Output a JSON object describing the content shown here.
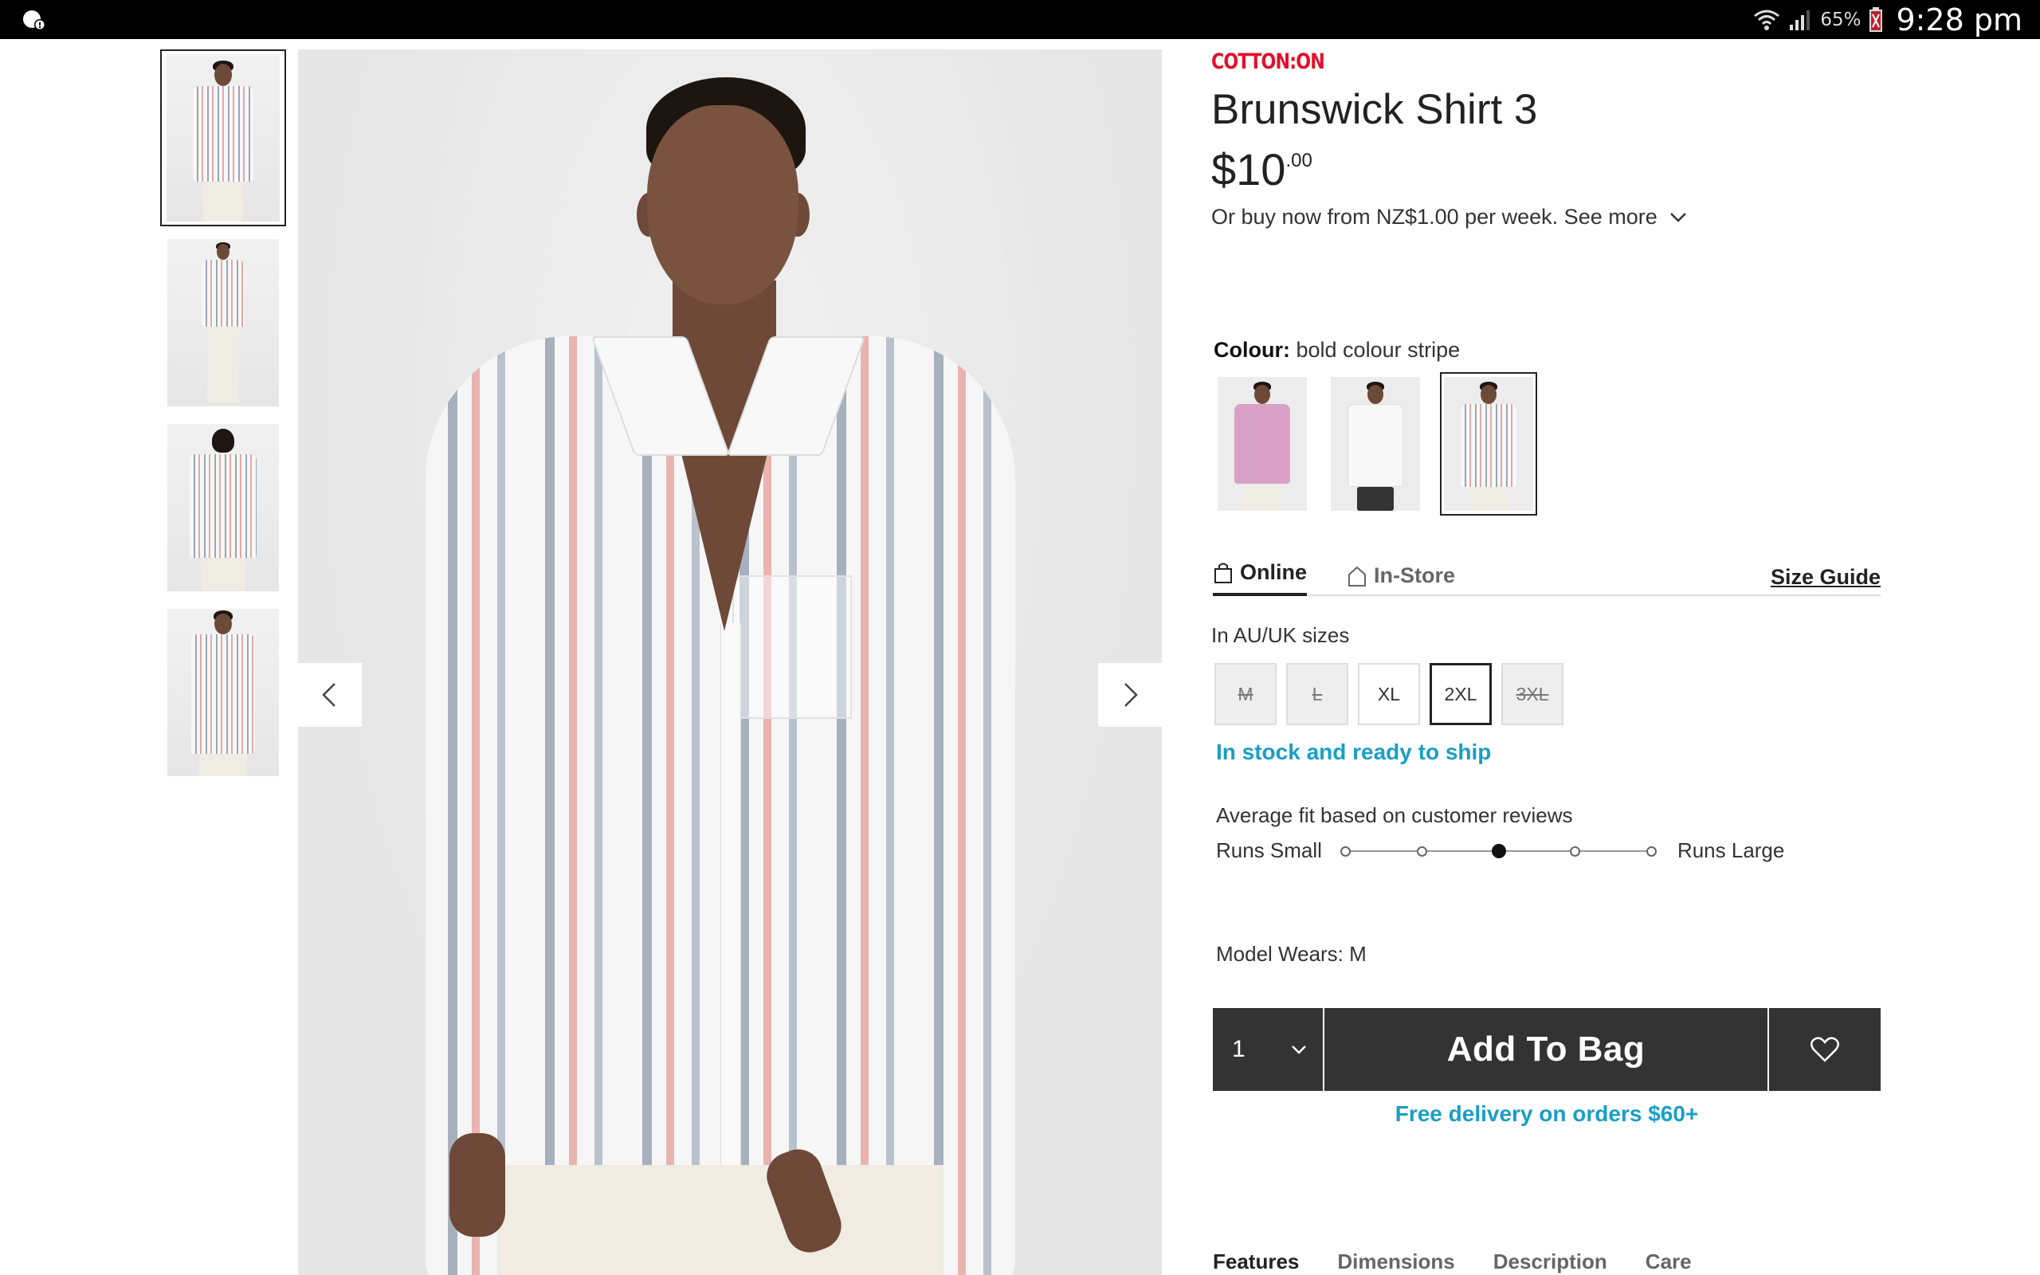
{
  "status_bar": {
    "battery": "65%",
    "time": "9:28 pm",
    "icons": [
      "notification-icon",
      "wifi-icon",
      "signal-icon",
      "battery-icon"
    ]
  },
  "gallery": {
    "thumbnails": [
      "front view",
      "full body",
      "back view",
      "side view"
    ],
    "active_index": 0,
    "prev_icon": "chevron-left-icon",
    "next_icon": "chevron-right-icon"
  },
  "product": {
    "brand": "COTTON:ON",
    "title": "Brunswick Shirt 3",
    "price_dollars": "$10",
    "price_cents": ".00",
    "installments": "Or buy now from NZ$1.00 per week. See more",
    "colour_label": "Colour:",
    "colour_value": "bold colour stripe",
    "colours": [
      "pink",
      "white",
      "bold colour stripe"
    ],
    "selected_colour_index": 2
  },
  "stock_tabs": {
    "online": "Online",
    "in_store": "In-Store",
    "size_guide": "Size Guide"
  },
  "sizes": {
    "note": "In AU/UK sizes",
    "options": [
      {
        "label": "M",
        "available": false
      },
      {
        "label": "L",
        "available": false
      },
      {
        "label": "XL",
        "available": true
      },
      {
        "label": "2XL",
        "available": true,
        "selected": true
      },
      {
        "label": "3XL",
        "available": false
      }
    ]
  },
  "availability": "In stock and ready to ship",
  "fit": {
    "title": "Average fit based on customer reviews",
    "left_label": "Runs Small",
    "right_label": "Runs Large",
    "steps": 5,
    "selected_step": 3
  },
  "model_wears": "Model Wears: M",
  "cart": {
    "quantity": "1",
    "add_label": "Add To Bag",
    "wishlist_icon": "heart-icon"
  },
  "free_delivery": "Free delivery on orders $60+",
  "info_tabs": [
    "Features",
    "Dimensions",
    "Description",
    "Care"
  ],
  "colors": {
    "brand_red": "#e1102b",
    "accent_blue": "#1a9ec4",
    "bag_bar": "#333333"
  }
}
